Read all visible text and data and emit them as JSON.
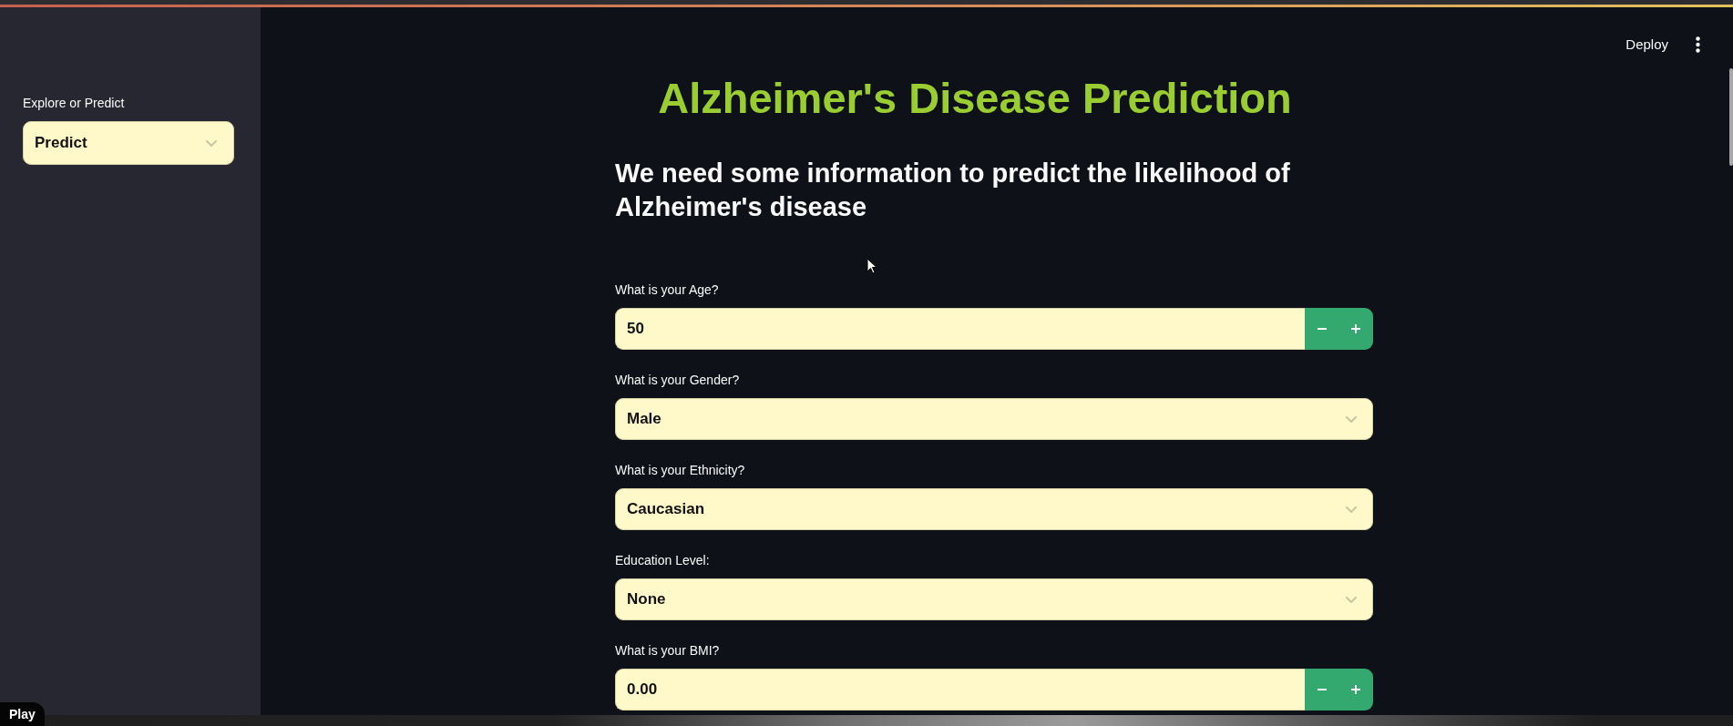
{
  "sidebar": {
    "select": {
      "label": "Explore or Predict",
      "value": "Predict"
    }
  },
  "header": {
    "deploy": "Deploy"
  },
  "main": {
    "title": "Alzheimer's Disease Prediction",
    "subtitle": "We need some information to predict the likelihood of Alzheimer's disease",
    "fields": [
      {
        "kind": "number",
        "label": "What is your Age?",
        "value": "50"
      },
      {
        "kind": "select",
        "label": "What is your Gender?",
        "value": "Male"
      },
      {
        "kind": "select",
        "label": "What is your Ethnicity?",
        "value": "Caucasian"
      },
      {
        "kind": "select",
        "label": "Education Level:",
        "value": "None"
      },
      {
        "kind": "number",
        "label": "What is your BMI?",
        "value": "0.00"
      }
    ]
  },
  "player": {
    "play": "Play"
  }
}
